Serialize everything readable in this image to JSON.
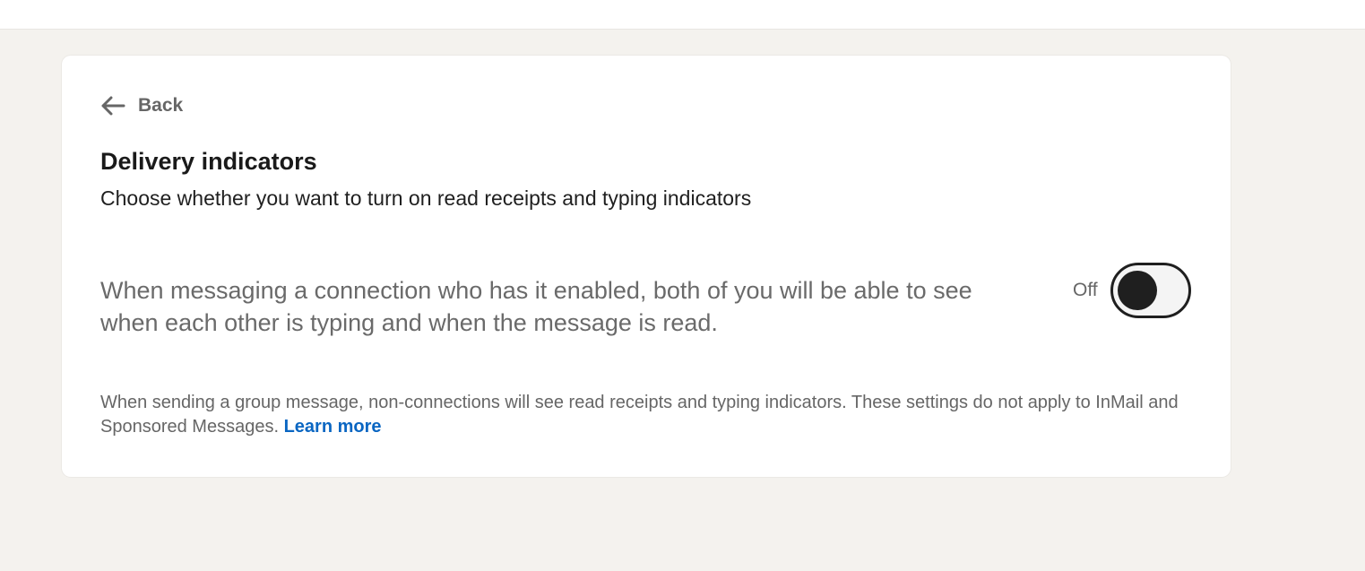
{
  "back": {
    "label": "Back",
    "icon": "arrow-left-icon"
  },
  "page": {
    "title": "Delivery indicators",
    "subtitle": "Choose whether you want to turn on read receipts and typing indicators"
  },
  "setting": {
    "description": "When messaging a connection who has it enabled, both of you will be able to see when each other is typing and when the message is read.",
    "state_label": "Off",
    "enabled": false
  },
  "footnote": {
    "text": "When sending a group message, non-connections will see read receipts and typing indicators. These settings do not apply to InMail and Sponsored Messages.",
    "link_label": "Learn more"
  },
  "colors": {
    "background": "#f4f2ee",
    "card": "#ffffff",
    "link": "#0a66c2",
    "toggle_dark": "#1f1f1f"
  }
}
